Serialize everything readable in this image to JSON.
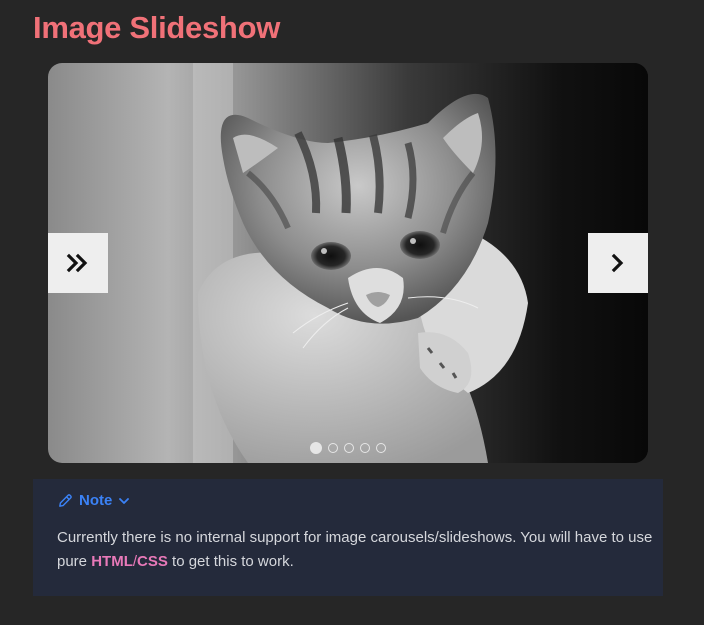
{
  "page": {
    "title": "Image Slideshow"
  },
  "carousel": {
    "image_alt": "black and white kitten",
    "prev_icon": "double-chevron-right-icon",
    "next_icon": "chevron-right-icon",
    "slide_count": 5,
    "active_index": 0
  },
  "note": {
    "label": "Note",
    "icon": "pencil-icon",
    "toggle_icon": "chevron-down-icon",
    "text_part1": "Currently there is no internal support for image carousels/slideshows. You will have to use pure ",
    "html_word": "HTML",
    "separator": "/",
    "css_word": "CSS",
    "text_part2": " to get this to work."
  },
  "colors": {
    "background": "#262626",
    "title": "#f07178",
    "note_background": "#242a3b",
    "note_accent": "#3b82f6",
    "highlight": "#e879b9"
  }
}
